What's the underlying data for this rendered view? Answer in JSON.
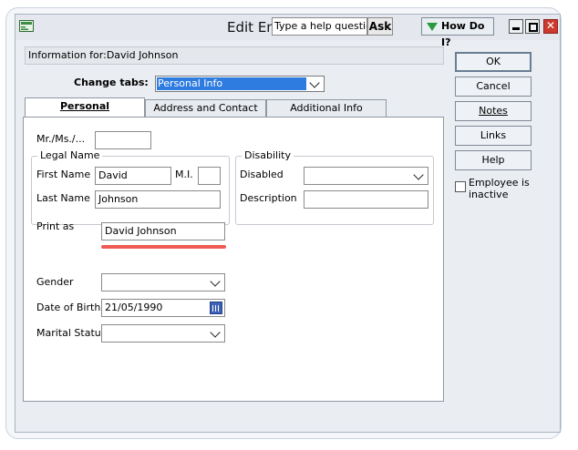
{
  "titlebar": {
    "title": "Edit Em",
    "help_placeholder": "Type a help question",
    "ask_label": "Ask",
    "howdoi_label": "How Do I?"
  },
  "info": {
    "label": "Information for:",
    "name": "David Johnson"
  },
  "change_tabs": {
    "label": "Change tabs:",
    "value": "Personal Info"
  },
  "tabs": [
    {
      "label": "Personal",
      "active": true
    },
    {
      "label": "Address and Contact",
      "active": false
    },
    {
      "label": "Additional Info",
      "active": false
    }
  ],
  "form": {
    "salutation_label": "Mr./Ms./...",
    "salutation_value": "",
    "legal_name_title": "Legal Name",
    "first_name_label": "First Name",
    "first_name_value": "David",
    "mi_label": "M.I.",
    "mi_value": "",
    "last_name_label": "Last Name",
    "last_name_value": "Johnson",
    "print_as_label": "Print as",
    "print_as_value": "David Johnson",
    "gender_label": "Gender",
    "gender_value": "",
    "dob_label": "Date of Birth",
    "dob_value": "21/05/1990",
    "marital_label": "Marital Status",
    "marital_value": ""
  },
  "disability": {
    "title": "Disability",
    "disabled_label": "Disabled",
    "disabled_value": "",
    "description_label": "Description",
    "description_value": ""
  },
  "side_buttons": {
    "ok": "OK",
    "cancel": "Cancel",
    "notes": "Notes",
    "links": "Links",
    "help": "Help"
  },
  "employee_inactive": {
    "label": "Employee is inactive",
    "checked": false
  },
  "colors": {
    "selection": "#2f7ce0",
    "highlight_underline": "#f05a55",
    "close_button": "#cc3a2f",
    "howdoi_arrow": "#2a9a3c"
  }
}
